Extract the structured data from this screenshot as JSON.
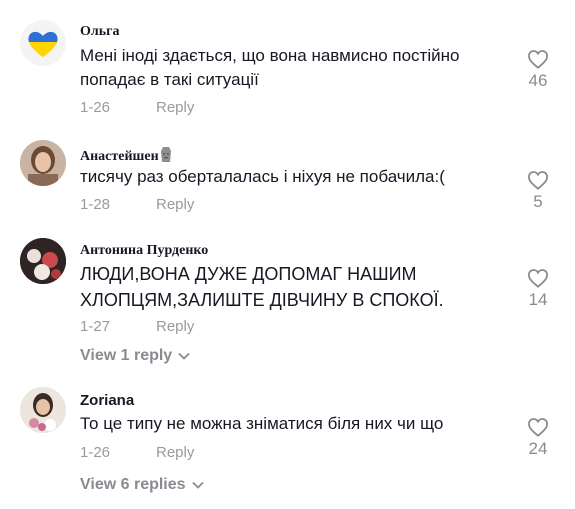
{
  "comments": [
    {
      "username": "Ольга",
      "text": "Мені іноді здається, що вона навмисно постійно попадає в такі ситуації",
      "date": "1-26",
      "reply_label": "Reply",
      "likes": "46",
      "avatar_icon": "heart-ukraine-flag-icon"
    },
    {
      "username": "Анастейшен",
      "text": "тисячу раз оберталалась і ніхуя не побачила:(",
      "date": "1-28",
      "reply_label": "Reply",
      "likes": "5",
      "badge_icon": "moai-emoji-icon"
    },
    {
      "username": "Антонина Пурденко",
      "text": "ЛЮДИ,ВОНА ДУЖЕ ДОПОМАГ НАШИМ ХЛОПЦЯМ,ЗАЛИШТЕ ДІВЧИНУ В СПОКОЇ.",
      "date": "1-27",
      "reply_label": "Reply",
      "likes": "14",
      "view_replies": "View 1 reply"
    },
    {
      "username": "Zoriana",
      "text": "То це типу не можна зніматися біля них чи що",
      "date": "1-26",
      "reply_label": "Reply",
      "likes": "24",
      "view_replies": "View 6 replies"
    }
  ],
  "colors": {
    "text": "#161823",
    "muted": "#8a8b91",
    "ukraine_blue": "#2f6fd6",
    "ukraine_yellow": "#ffd500"
  }
}
